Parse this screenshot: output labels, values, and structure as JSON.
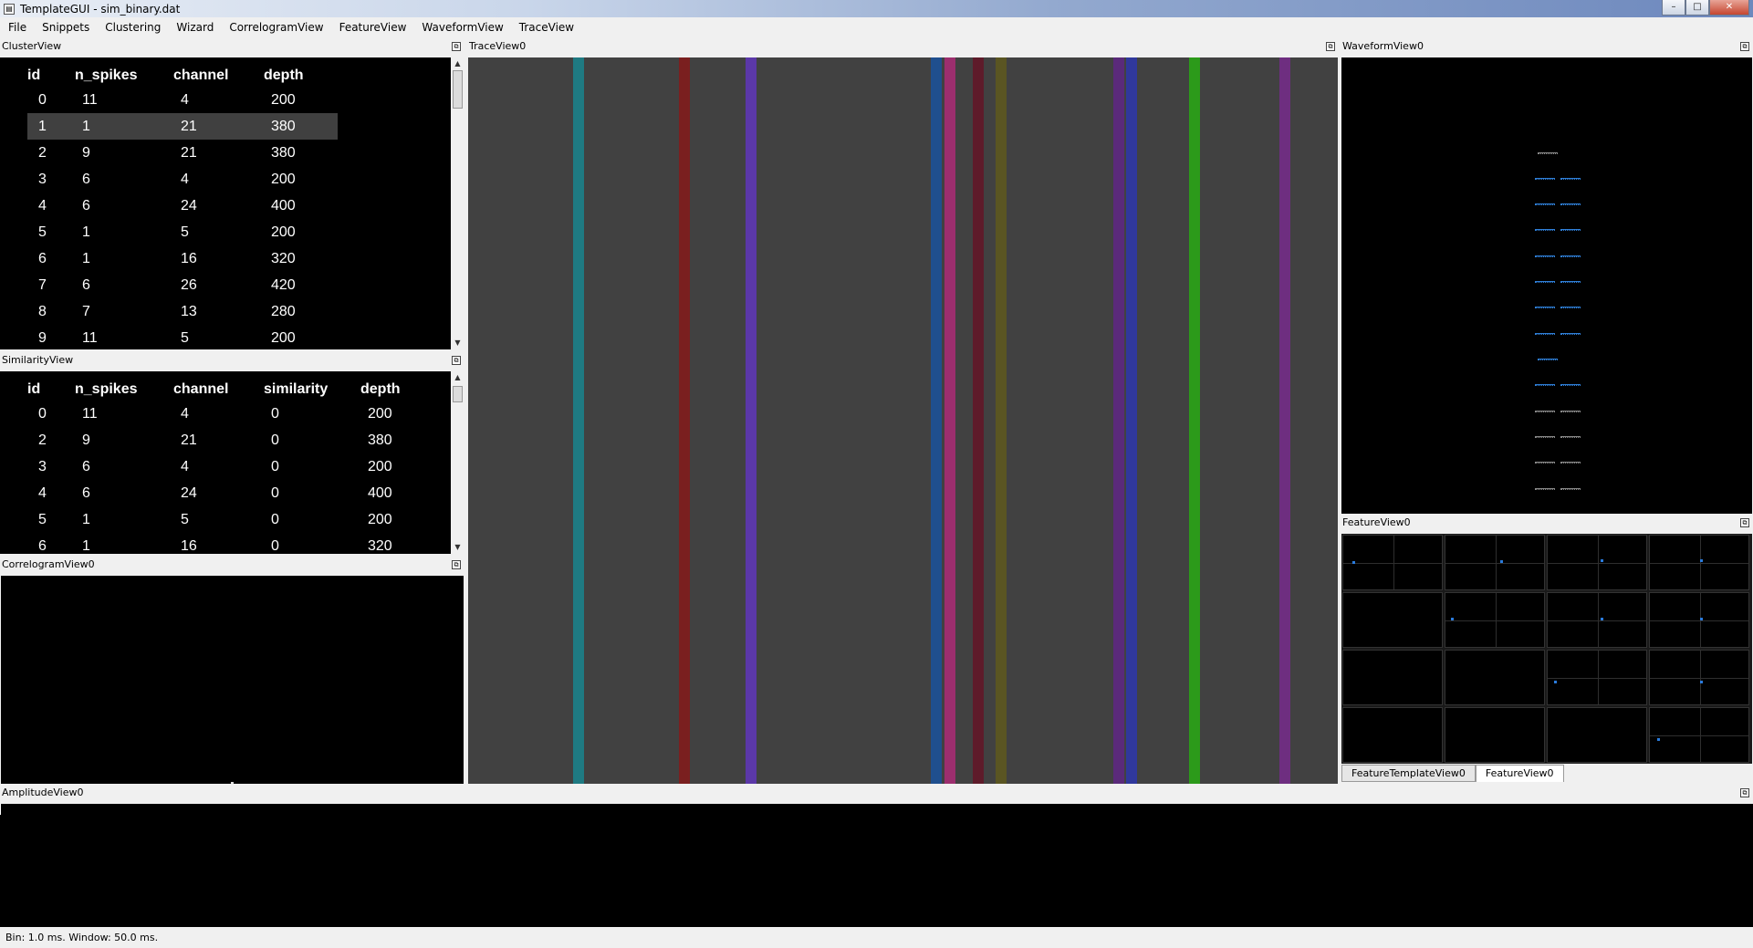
{
  "window": {
    "title": "TemplateGUI - sim_binary.dat",
    "minimize": "–",
    "maximize": "□",
    "close": "✕"
  },
  "menu": [
    "File",
    "Snippets",
    "Clustering",
    "Wizard",
    "CorrelogramView",
    "FeatureView",
    "WaveformView",
    "TraceView"
  ],
  "cluster_view": {
    "title": "ClusterView",
    "columns": [
      "id",
      "n_spikes",
      "channel",
      "depth"
    ],
    "rows": [
      [
        "0",
        "11",
        "4",
        "200"
      ],
      [
        "1",
        "1",
        "21",
        "380"
      ],
      [
        "2",
        "9",
        "21",
        "380"
      ],
      [
        "3",
        "6",
        "4",
        "200"
      ],
      [
        "4",
        "6",
        "24",
        "400"
      ],
      [
        "5",
        "1",
        "5",
        "200"
      ],
      [
        "6",
        "1",
        "16",
        "320"
      ],
      [
        "7",
        "6",
        "26",
        "420"
      ],
      [
        "8",
        "7",
        "13",
        "280"
      ],
      [
        "9",
        "11",
        "5",
        "200"
      ]
    ],
    "selected_row": 1
  },
  "similarity_view": {
    "title": "SimilarityView",
    "columns": [
      "id",
      "n_spikes",
      "channel",
      "similarity",
      "depth"
    ],
    "rows": [
      [
        "0",
        "11",
        "4",
        "0",
        "200"
      ],
      [
        "2",
        "9",
        "21",
        "0",
        "380"
      ],
      [
        "3",
        "6",
        "4",
        "0",
        "200"
      ],
      [
        "4",
        "6",
        "24",
        "0",
        "400"
      ],
      [
        "5",
        "1",
        "5",
        "0",
        "200"
      ],
      [
        "6",
        "1",
        "16",
        "0",
        "320"
      ]
    ]
  },
  "correlogram_view": {
    "title": "CorrelogramView0"
  },
  "trace_view": {
    "title": "TraceView0",
    "bands": [
      {
        "color": "#1f7a82"
      },
      {
        "color": "#7a1f1f"
      },
      {
        "color": "#5b38a8"
      },
      {
        "color": "#1f4f8e"
      },
      {
        "color": "#9c2e6e"
      },
      {
        "color": "#5e1b2a"
      },
      {
        "color": "#5a5522"
      },
      {
        "color": "#5a2a7a"
      },
      {
        "color": "#30389c"
      },
      {
        "color": "#2c9a1a"
      },
      {
        "color": "#6e2e80"
      }
    ]
  },
  "waveform_view": {
    "title": "WaveformView0",
    "blue": "#2f7fd8",
    "gray": "#8a8a8a"
  },
  "feature_view": {
    "title": "FeatureView0",
    "dot_color": "#2a7bdc"
  },
  "feature_tabs": [
    "FeatureTemplateView0",
    "FeatureView0"
  ],
  "amplitude_view": {
    "title": "AmplitudeView0"
  },
  "status": "Bin: 1.0 ms. Window: 50.0 ms."
}
